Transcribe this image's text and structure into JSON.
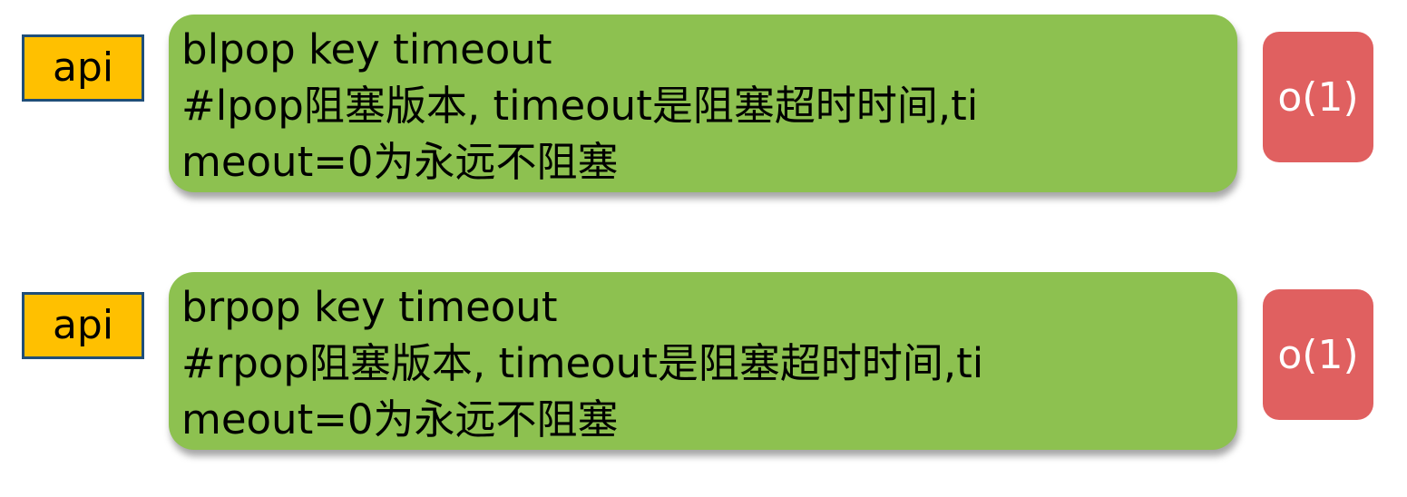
{
  "colors": {
    "api_tag_fill": "#ffc000",
    "api_tag_border": "#1f4e79",
    "command_box_fill": "#8dc150",
    "complexity_fill": "#e06060"
  },
  "rows": [
    {
      "tag": "api",
      "command": "blpop key timeout",
      "description": "#lpop阻塞版本, timeout是阻塞超时时间,timeout=0为永远不阻塞",
      "complexity": "o(1)"
    },
    {
      "tag": "api",
      "command": "brpop key timeout",
      "description": "#rpop阻塞版本, timeout是阻塞超时时间,timeout=0为永远不阻塞",
      "complexity": "o(1)"
    }
  ]
}
